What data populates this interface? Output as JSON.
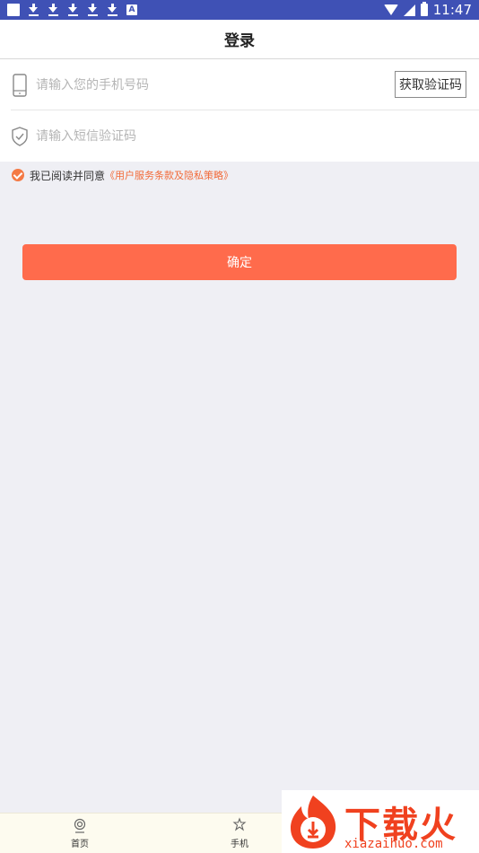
{
  "status_bar": {
    "time": "11:47",
    "a_icon_label": "A"
  },
  "header": {
    "title": "登录"
  },
  "form": {
    "phone_placeholder": "请输入您的手机号码",
    "get_code_label": "获取验证码",
    "code_placeholder": "请输入短信验证码"
  },
  "agreement": {
    "text": "我已阅读并同意",
    "link": "《用户服务条款及隐私策略》"
  },
  "confirm_label": "确定",
  "bottom_nav": {
    "items": [
      {
        "label": "首页",
        "icon": "home-icon"
      },
      {
        "label": "手机",
        "icon": "phone-nav-icon"
      }
    ]
  },
  "watermark": {
    "title": "下载火",
    "subtitle": "xiazaihuo.com"
  },
  "colors": {
    "accent": "#ff6b4c",
    "status_bar": "#3f51b5",
    "background": "#efeff4"
  }
}
